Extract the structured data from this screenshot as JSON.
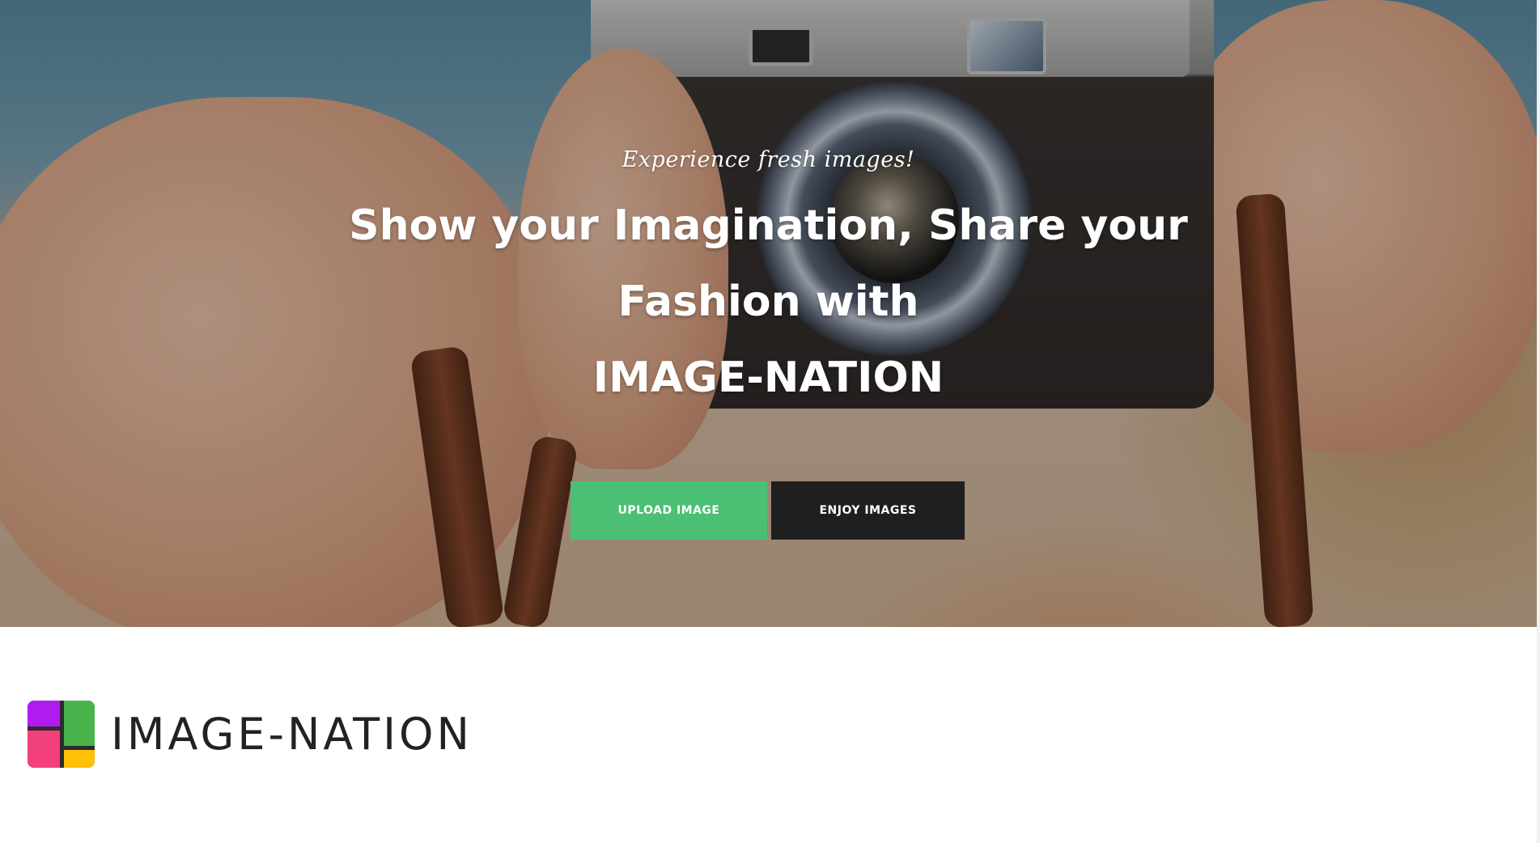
{
  "hero": {
    "tagline": "Experience fresh images!",
    "headline": "Show your Imagination, Share your Fashion with",
    "brand": "IMAGE-NATION",
    "buttons": {
      "upload_label": "UPLOAD IMAGE",
      "enjoy_label": "ENJOY IMAGES"
    }
  },
  "logo": {
    "text": "IMAGE-NATION",
    "icon": "four-square-logo-icon"
  },
  "colors": {
    "upload_button": "#4bbf73",
    "enjoy_button": "#1f1f1f",
    "logo_purple": "#b11bf0",
    "logo_green": "#47b34a",
    "logo_pink": "#f2407a",
    "logo_yellow": "#ffc107"
  }
}
